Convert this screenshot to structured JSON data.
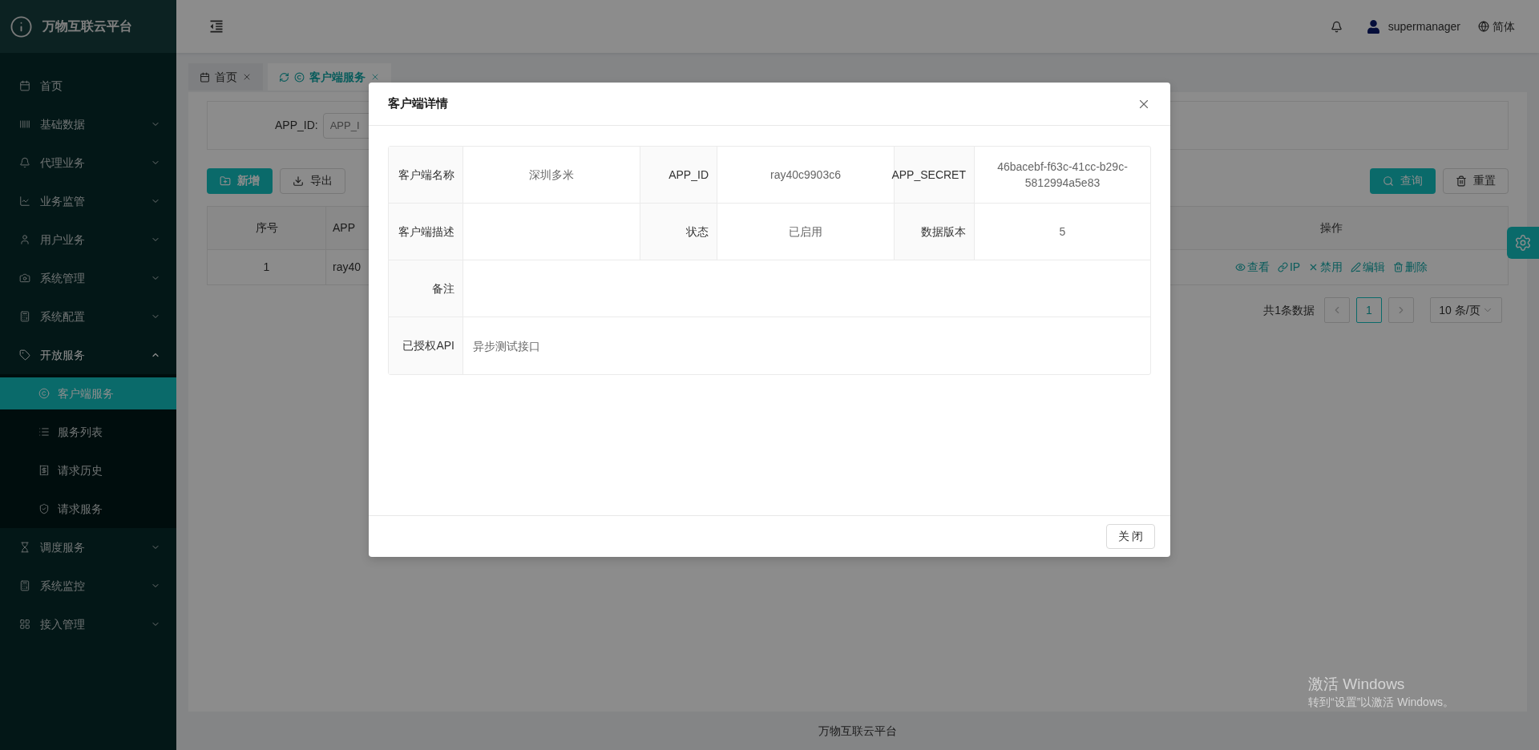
{
  "sidebar": {
    "brand": "万物互联云平台",
    "items": [
      {
        "kind": "link",
        "label": "首页",
        "selected": false
      },
      {
        "kind": "group",
        "label": "基础数据",
        "expanded": false
      },
      {
        "kind": "group",
        "label": "代理业务",
        "expanded": false
      },
      {
        "kind": "group",
        "label": "业务监管",
        "expanded": false
      },
      {
        "kind": "group",
        "label": "用户业务",
        "expanded": false
      },
      {
        "kind": "group",
        "label": "系统管理",
        "expanded": false
      },
      {
        "kind": "group",
        "label": "系统配置",
        "expanded": false
      },
      {
        "kind": "group",
        "label": "开放服务",
        "expanded": true,
        "children": [
          {
            "label": "客户端服务",
            "selected": true
          },
          {
            "label": "服务列表",
            "selected": false
          },
          {
            "label": "请求历史",
            "selected": false
          },
          {
            "label": "请求服务",
            "selected": false
          }
        ]
      },
      {
        "kind": "group",
        "label": "调度服务",
        "expanded": false
      },
      {
        "kind": "group",
        "label": "系统监控",
        "expanded": false
      },
      {
        "kind": "group",
        "label": "接入管理",
        "expanded": false
      }
    ]
  },
  "header": {
    "user": "supermanager",
    "language": "简体"
  },
  "tabs": [
    {
      "label": "首页",
      "selected": false
    },
    {
      "label": "客户端服务",
      "selected": true
    }
  ],
  "search_form": {
    "label": "APP_ID:",
    "placeholder": "APP_I"
  },
  "toolbar": {
    "left_buttons": [
      "新增",
      "导出"
    ],
    "right_buttons": [
      "查询",
      "重置"
    ]
  },
  "table": {
    "columns": [
      "序号",
      "APP",
      "操作"
    ],
    "rows": [
      {
        "cells": [
          "1",
          "ray40"
        ],
        "actions": [
          "查看",
          "IP",
          "禁用",
          "编辑",
          "删除"
        ]
      }
    ]
  },
  "pagination": {
    "total": "共1条数据",
    "pages": [
      {
        "label": "1",
        "selected": true
      }
    ],
    "page_size": "10 条/页"
  },
  "footer": "万物互联云平台",
  "os_notice": {
    "title": "激活 Windows",
    "text": "转到“设置”以激活 Windows。"
  },
  "dialog": {
    "title": "客户端详情",
    "rows": [
      {
        "cells": [
          {
            "label": "客户端名称",
            "value": "深圳多米"
          },
          {
            "label": "APP_ID",
            "value": "ray40c9903c6"
          },
          {
            "label": "APP_SECRET",
            "value": "46bacebf-f63c-41cc-b29c-5812994a5e83"
          }
        ]
      },
      {
        "cells": [
          {
            "label": "客户端描述"
          },
          {
            "label": "状态",
            "value": "已启用"
          },
          {
            "label": "数据版本",
            "value": "5"
          }
        ]
      },
      {
        "cells": [
          {
            "label": "备注"
          }
        ]
      },
      {
        "cells": [
          {
            "label": "已授权API",
            "value": "异步测试接口"
          }
        ]
      }
    ],
    "close_button": "关 闭"
  }
}
